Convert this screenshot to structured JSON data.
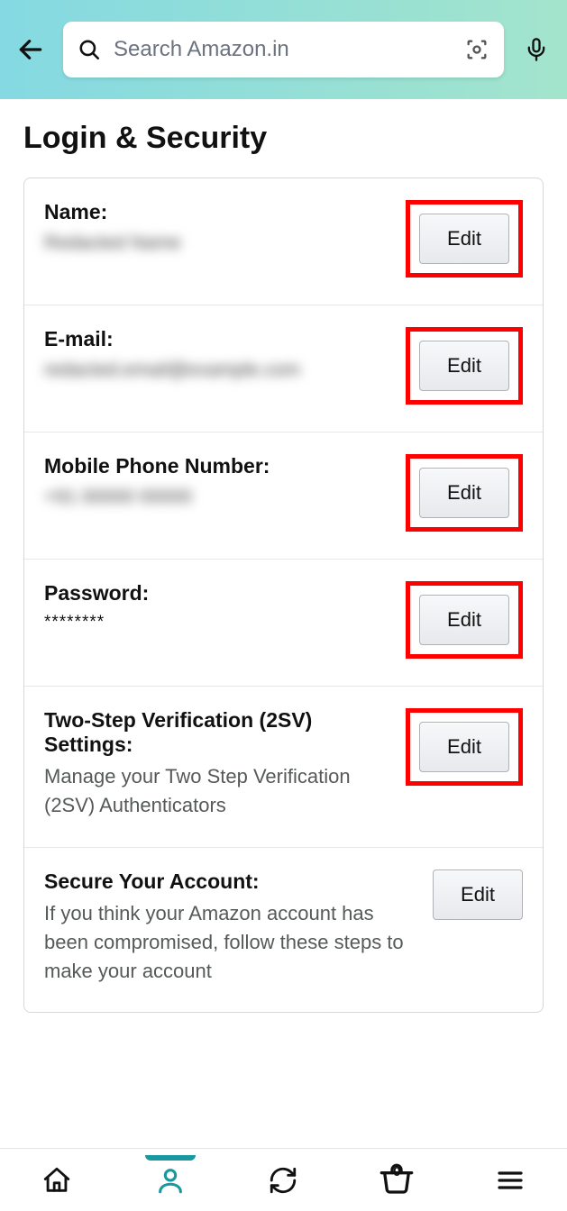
{
  "header": {
    "search_placeholder": "Search Amazon.in"
  },
  "page": {
    "title": "Login & Security"
  },
  "rows": {
    "name": {
      "label": "Name:",
      "value": "Redacted Name",
      "edit": "Edit"
    },
    "email": {
      "label": "E-mail:",
      "value": "redacted.email@example.com",
      "edit": "Edit"
    },
    "mobile": {
      "label": "Mobile Phone Number:",
      "value": "+91 00000 00000",
      "edit": "Edit"
    },
    "password": {
      "label": "Password:",
      "value": "********",
      "edit": "Edit"
    },
    "twosv": {
      "label": "Two-Step Verification (2SV) Settings:",
      "desc": "Manage your Two Step Verification (2SV) Authenticators",
      "edit": "Edit"
    },
    "secure": {
      "label": "Secure Your Account:",
      "desc": "If you think your Amazon account has been compromised, follow these steps to make your account",
      "edit": "Edit"
    }
  },
  "nav": {
    "cart_count": "0"
  }
}
